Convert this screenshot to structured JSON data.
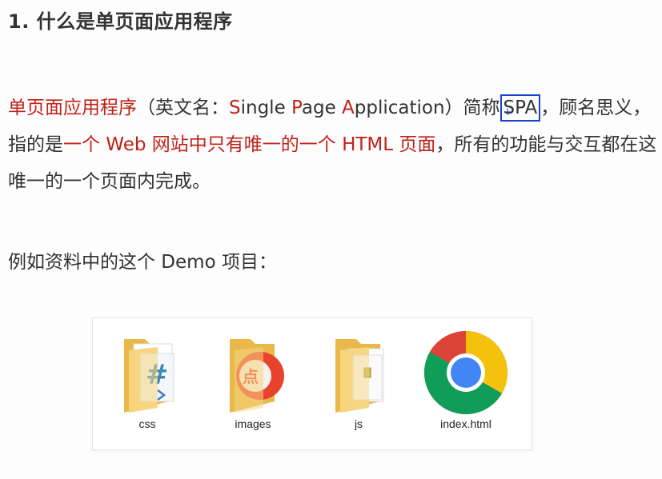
{
  "heading": "1. 什么是单页面应用程序",
  "paragraph1": {
    "spa_term": "单页面应用程序",
    "open_paren": "（英文名：",
    "s_letter": "S",
    "ingle": "ingle ",
    "p_letter": "P",
    "age": "age ",
    "a_letter": "A",
    "pplication": "pplication",
    "close_paren_abbr": "）简称",
    "abbr": "SPA",
    "after_abbr": "，顾名思义，指的是",
    "highlight": "一个 Web 网站中只有唯一的一个 HTML 页面",
    "ending": "，所有的功能与交互都在这唯一的一个页面内完成。"
  },
  "paragraph2": "例如资料中的这个 Demo 项目：",
  "demo": {
    "items": [
      {
        "label": "css",
        "icon": "css-folder-icon"
      },
      {
        "label": "images",
        "icon": "images-folder-icon"
      },
      {
        "label": "js",
        "icon": "js-folder-icon"
      },
      {
        "label": "index.html",
        "icon": "chrome-icon"
      }
    ]
  },
  "colors": {
    "text": "#333333",
    "highlight_red": "#c0221a",
    "selection_blue": "#1a3fd1",
    "folder_yellow": "#f5d27a"
  }
}
